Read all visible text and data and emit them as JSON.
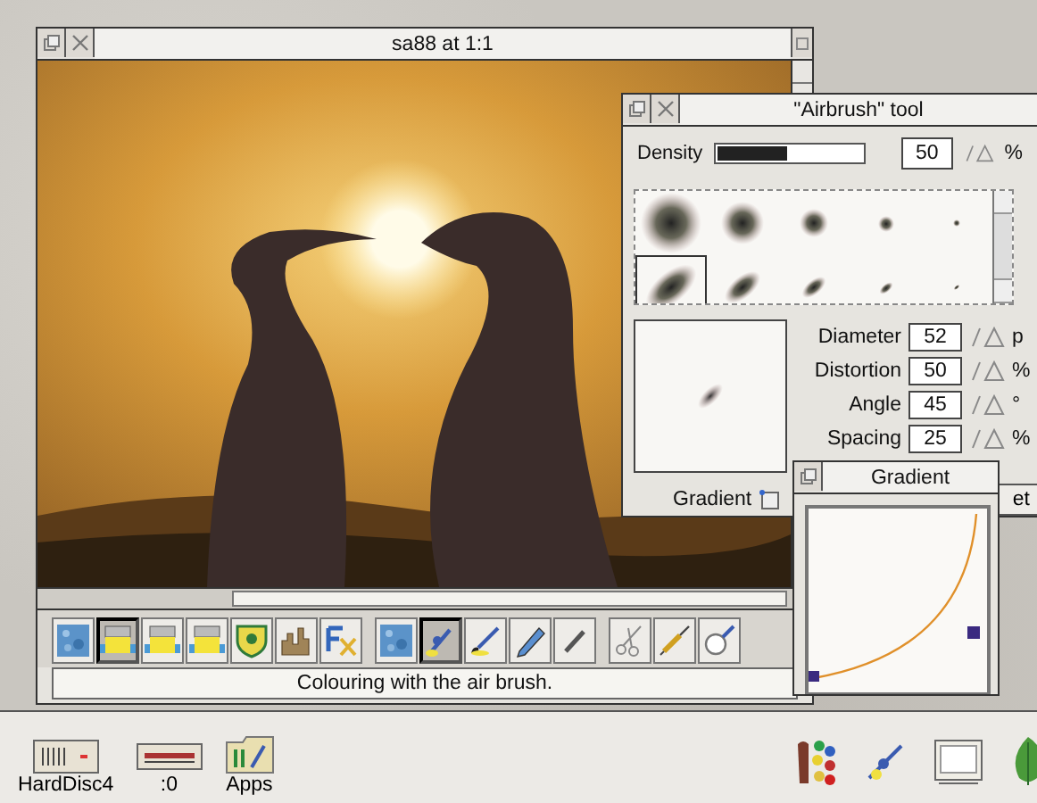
{
  "main_window": {
    "title": "sa88 at 1:1",
    "tools": [
      {
        "kind": "texture",
        "selected": false
      },
      {
        "kind": "fill",
        "selected": true
      },
      {
        "kind": "fill",
        "selected": false
      },
      {
        "kind": "fill",
        "selected": false
      },
      {
        "kind": "shield",
        "selected": false
      },
      {
        "kind": "chart",
        "selected": false
      },
      {
        "kind": "effects",
        "selected": false
      },
      {
        "kind": "texture",
        "selected": false
      },
      {
        "kind": "airbrush",
        "selected": true
      },
      {
        "kind": "paintbrush",
        "selected": false
      },
      {
        "kind": "pencil",
        "selected": false
      },
      {
        "kind": "line",
        "selected": false
      },
      {
        "kind": "scissors",
        "selected": false
      },
      {
        "kind": "syringe",
        "selected": false
      },
      {
        "kind": "magnifier",
        "selected": false
      }
    ],
    "status": "Colouring with the air brush."
  },
  "airbrush_window": {
    "title": "\"Airbrush\" tool",
    "density": {
      "label": "Density",
      "level": 0.48,
      "value": "50",
      "unit": "%"
    },
    "brushes": [
      {
        "selected": false
      },
      {
        "selected": false
      },
      {
        "selected": false
      },
      {
        "selected": false
      },
      {
        "selected": false
      },
      {
        "selected": true
      },
      {
        "selected": false
      },
      {
        "selected": false
      },
      {
        "selected": false
      },
      {
        "selected": false
      }
    ],
    "settings": [
      {
        "label": "Diameter",
        "value": "52",
        "unit": "p"
      },
      {
        "label": "Distortion",
        "value": "50",
        "unit": "%"
      },
      {
        "label": "Angle",
        "value": "45",
        "unit": "°"
      },
      {
        "label": "Spacing",
        "value": "25",
        "unit": "%"
      }
    ],
    "gradient_label": "Gradient",
    "cut_button": "et"
  },
  "gradient_window": {
    "title": "Gradient"
  },
  "icon_bar": {
    "left": [
      {
        "kind": "harddisc",
        "label": "HardDisc4"
      },
      {
        "kind": "floppy",
        "label": ":0"
      },
      {
        "kind": "folder",
        "label": "Apps"
      }
    ],
    "right": [
      {
        "kind": "palette"
      },
      {
        "kind": "airbrush"
      },
      {
        "kind": "monitor"
      },
      {
        "kind": "leaf"
      }
    ]
  }
}
